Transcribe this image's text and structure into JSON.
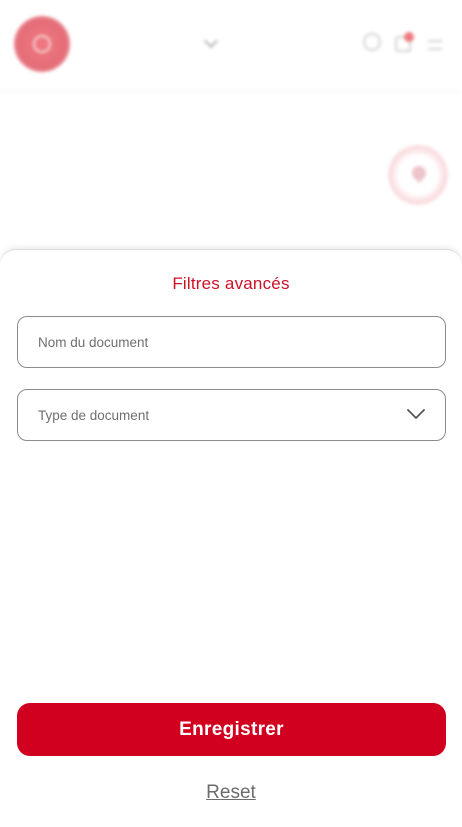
{
  "background": {
    "user_name": "",
    "page_title": "",
    "icons": [
      "logo",
      "chevron-down-icon",
      "help-icon",
      "bell-icon",
      "menu-icon",
      "filter-icon"
    ]
  },
  "sheet": {
    "title": "Filtres avancés",
    "name_field": {
      "placeholder": "Nom du document",
      "value": ""
    },
    "type_field": {
      "placeholder": "Type de document",
      "value": ""
    },
    "save_label": "Enregistrer",
    "reset_label": "Reset"
  },
  "colors": {
    "accent": "#d1001f",
    "title": "#cd1127",
    "field_border": "#8c8c8c"
  }
}
